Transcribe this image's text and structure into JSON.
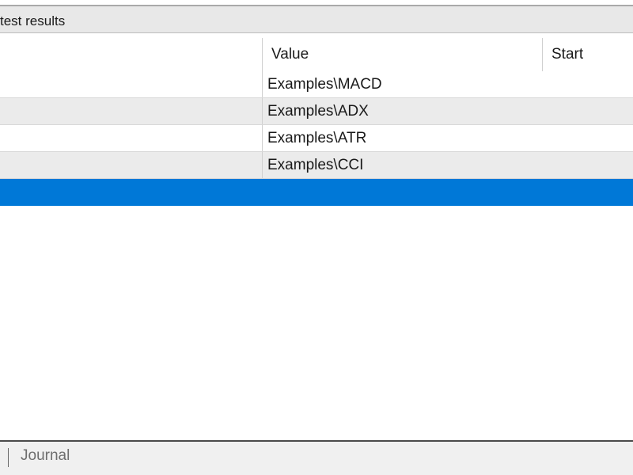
{
  "panel": {
    "title": "test results"
  },
  "columns": [
    {
      "label": ""
    },
    {
      "label": "Value"
    },
    {
      "label": "Start"
    }
  ],
  "rows": [
    {
      "value": "Examples\\MACD"
    },
    {
      "value": "Examples\\ADX"
    },
    {
      "value": "Examples\\ATR"
    },
    {
      "value": "Examples\\CCI"
    }
  ],
  "selected_row_index": 4,
  "bottom_tabs": [
    {
      "label": "Journal"
    }
  ],
  "colors": {
    "selection": "#0078d7",
    "alt_row": "#ebebeb"
  }
}
